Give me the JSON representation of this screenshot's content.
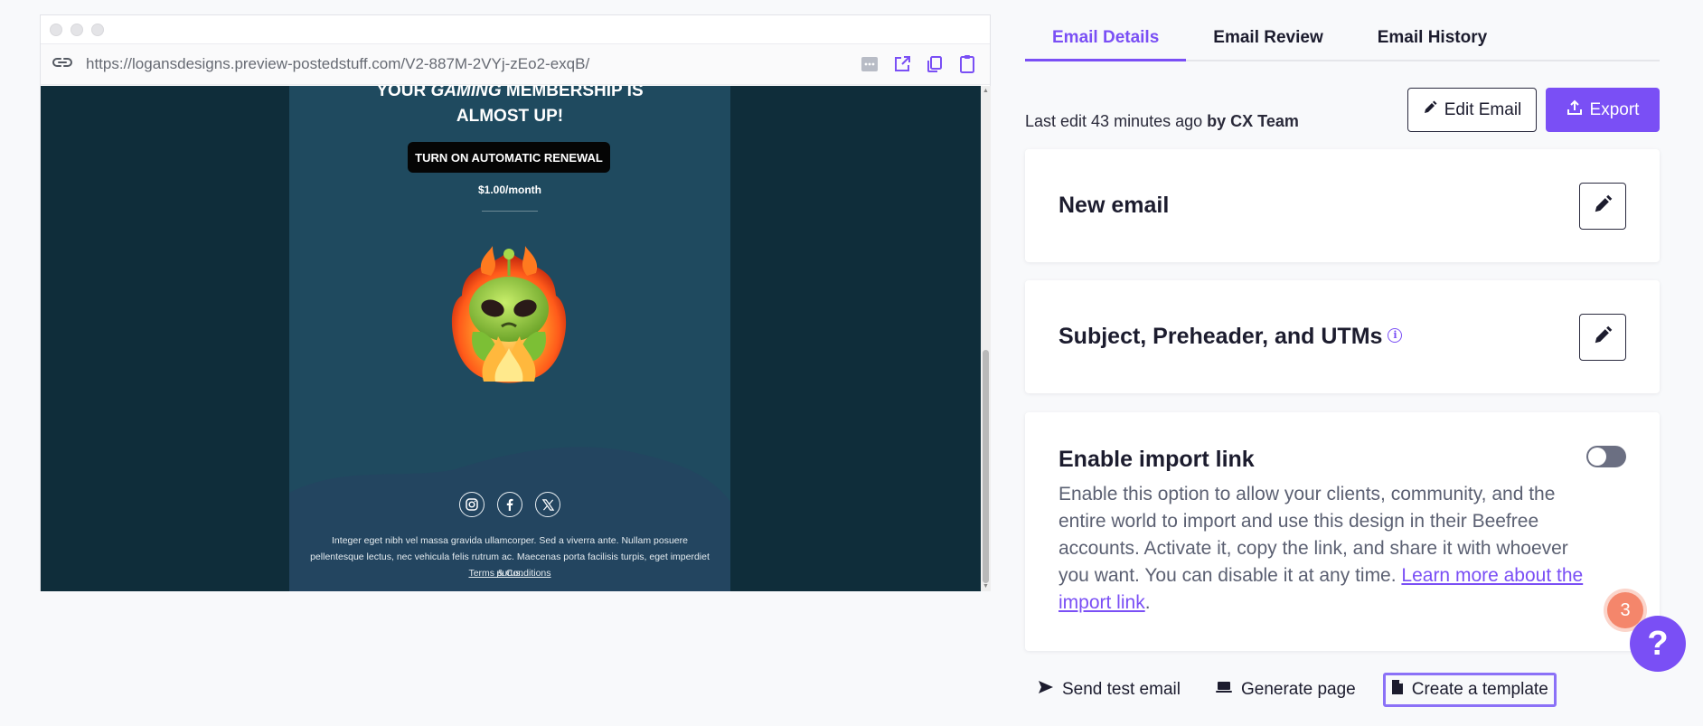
{
  "browser": {
    "url": "https://logansdesigns.preview-postedstuff.com/V2-887M-2VYj-zEo2-exqB/"
  },
  "email_preview": {
    "headline_pre": "YOUR ",
    "headline_em": "GAMING",
    "headline_post": " MEMBERSHIP IS",
    "headline_line2": "ALMOST UP!",
    "cta_label": "TURN ON AUTOMATIC RENEWAL",
    "price": "$1.00/month",
    "footer_text": "Integer eget nibh vel massa gravida ullamcorper. Sed a viverra ante. Nullam posuere pellentesque lectus, nec vehicula felis rutrum ac. Maecenas porta facilisis turpis, eget imperdiet purus.",
    "terms_label": "Terms & Conditions",
    "social_icons": [
      "instagram-icon",
      "facebook-icon",
      "x-twitter-icon"
    ],
    "colors": {
      "background": "#0f2d3a",
      "body": "#1f4a5f",
      "footer": "#234560"
    }
  },
  "tabs": [
    {
      "label": "Email Details",
      "active": true
    },
    {
      "label": "Email Review",
      "active": false
    },
    {
      "label": "Email History",
      "active": false
    }
  ],
  "last_edit": {
    "prefix": "Last edit 43 minutes ago",
    "by": "by CX Team"
  },
  "toolbar": {
    "edit_label": "Edit Email",
    "export_label": "Export"
  },
  "cards": {
    "new_email_title": "New email",
    "subject_title": "Subject, Preheader, and UTMs",
    "import_title": "Enable import link",
    "import_desc": "Enable this option to allow your clients, community, and the entire world to import and use this design in their Beefree accounts. Activate it, copy the link, and share it with whoever you want. You can disable it at any time. ",
    "import_link": "Learn more about the import link",
    "import_desc_end": ".",
    "import_enabled": false
  },
  "actions": {
    "send_test": "Send test email",
    "generate_page": "Generate page",
    "create_template": "Create a template"
  },
  "notification_count": "3",
  "help_label": "?",
  "accent_color": "#7a4ff5"
}
